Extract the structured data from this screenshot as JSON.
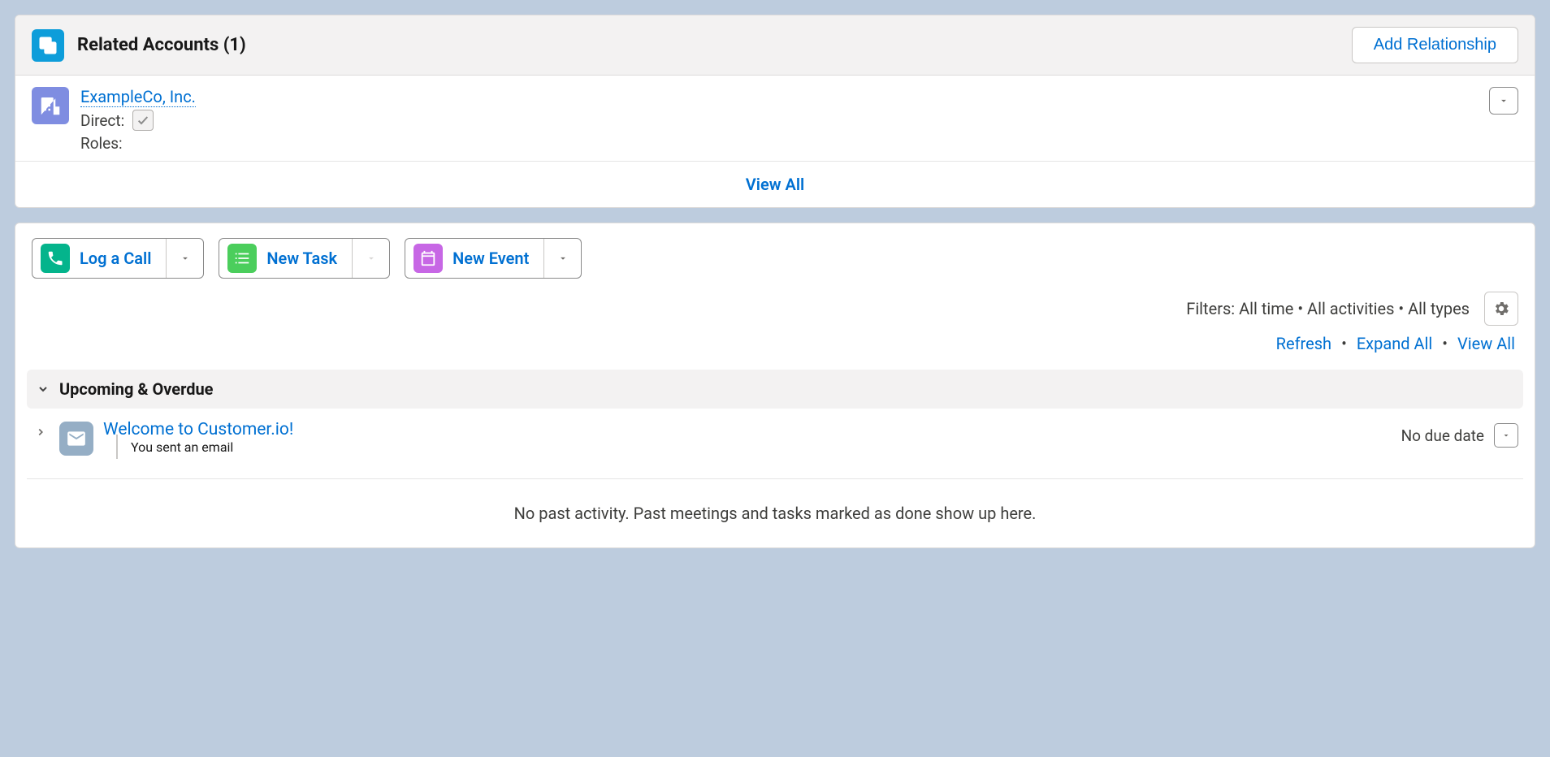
{
  "related": {
    "title": "Related Accounts (1)",
    "add_button": "Add Relationship",
    "account": {
      "name": "ExampleCo, Inc.",
      "direct_label": "Direct:",
      "roles_label": "Roles:"
    },
    "view_all": "View All"
  },
  "activity": {
    "buttons": {
      "log_call": "Log a Call",
      "new_task": "New Task",
      "new_event": "New Event"
    },
    "filters_label": "Filters: All time • All activities • All types",
    "links": {
      "refresh": "Refresh",
      "expand_all": "Expand All",
      "view_all": "View All"
    },
    "section_title": "Upcoming & Overdue",
    "item": {
      "title": "Welcome to Customer.io!",
      "sub": "You sent an email",
      "due": "No due date"
    },
    "empty": "No past activity. Past meetings and tasks marked as done show up here."
  }
}
